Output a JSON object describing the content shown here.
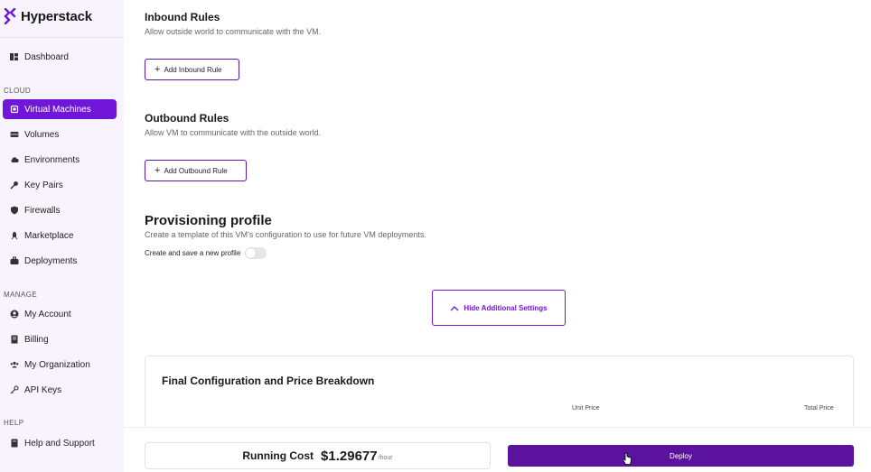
{
  "brand": {
    "name": "Hyperstack",
    "accent": "#6f16d9"
  },
  "sidebar": {
    "dashboard": "Dashboard",
    "sections": {
      "cloud": "CLOUD",
      "manage": "MANAGE",
      "help": "HELP"
    },
    "cloud_items": [
      {
        "label": "Virtual Machines",
        "icon": "chip-icon",
        "active": true
      },
      {
        "label": "Volumes",
        "icon": "volume-icon"
      },
      {
        "label": "Environments",
        "icon": "cloud-icon"
      },
      {
        "label": "Key Pairs",
        "icon": "key-icon"
      },
      {
        "label": "Firewalls",
        "icon": "shield-icon"
      },
      {
        "label": "Marketplace",
        "icon": "rocket-icon"
      },
      {
        "label": "Deployments",
        "icon": "briefcase-icon"
      }
    ],
    "manage_items": [
      {
        "label": "My Account",
        "icon": "user-circle-icon"
      },
      {
        "label": "Billing",
        "icon": "receipt-icon"
      },
      {
        "label": "My Organization",
        "icon": "users-icon"
      },
      {
        "label": "API Keys",
        "icon": "api-key-icon"
      }
    ],
    "help_items": [
      {
        "label": "Help and Support",
        "icon": "help-book-icon"
      }
    ]
  },
  "inbound": {
    "title": "Inbound Rules",
    "description": "Allow outside world to communicate with the VM.",
    "button": "Add Inbound Rule"
  },
  "outbound": {
    "title": "Outbound Rules",
    "description": "Allow VM to communicate with the outside world.",
    "button": "Add Outbound Rule"
  },
  "provisioning": {
    "title": "Provisioning profile",
    "description": "Create a template of this VM's configuration to use for future VM deployments.",
    "toggle_label": "Create and save a new profile",
    "toggle_on": false
  },
  "hide_settings": {
    "label": "Hide Additional Settings"
  },
  "final_config": {
    "title": "Final Configuration and Price Breakdown",
    "unit_price_header": "Unit Price",
    "total_price_header": "Total Price"
  },
  "footer": {
    "running_cost_label": "Running Cost",
    "running_cost_value": "$1.29677",
    "running_cost_unit": "/hour",
    "deploy_label": "Deploy"
  }
}
